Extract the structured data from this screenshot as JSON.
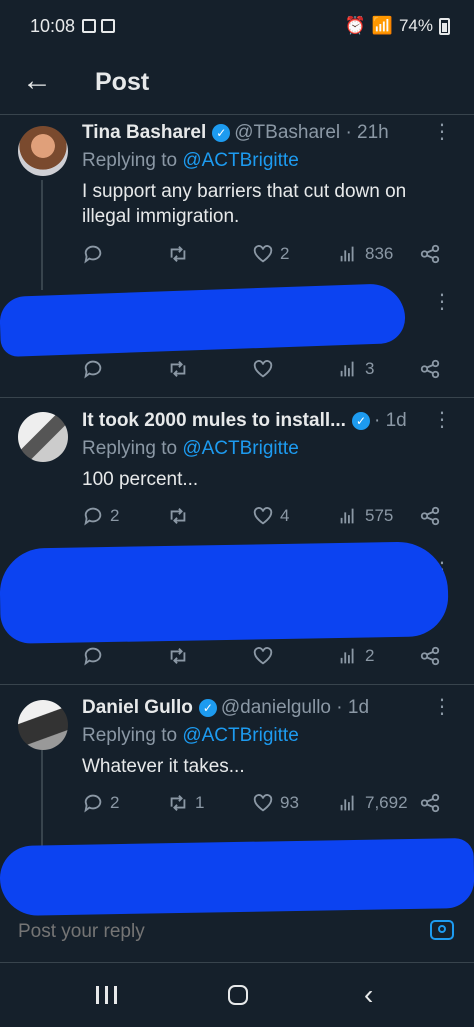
{
  "status": {
    "time": "10:08",
    "battery": "74%"
  },
  "header": {
    "title": "Post"
  },
  "posts": [
    {
      "name": "Tina Basharel",
      "handle": "@TBasharel",
      "time": "· 21h",
      "replying_prefix": "Replying to ",
      "replying_to": "@ACTBrigitte",
      "text": "I support any barriers that cut down on illegal immigration.",
      "replies": "",
      "reposts": "",
      "likes": "2",
      "views": "836"
    },
    {
      "name": "",
      "handle": "",
      "time": "",
      "replying_prefix": "",
      "replying_to": "",
      "text": "",
      "replies": "",
      "reposts": "",
      "likes": "",
      "views": "3"
    },
    {
      "name": "It took 2000 mules to install...",
      "handle": "",
      "time": "· 1d",
      "replying_prefix": "Replying to ",
      "replying_to": "@ACTBrigitte",
      "text": "100 percent...",
      "replies": "2",
      "reposts": "",
      "likes": "4",
      "views": "575"
    },
    {
      "name": "",
      "handle": "",
      "time": "",
      "replying_prefix": "",
      "replying_to": "",
      "text": "",
      "replies": "",
      "reposts": "",
      "likes": "",
      "views": "2"
    },
    {
      "name": "Daniel Gullo",
      "handle": "@danielgullo",
      "time": "· 1d",
      "replying_prefix": "Replying to ",
      "replying_to": "@ACTBrigitte",
      "text": "Whatever it takes...",
      "replies": "2",
      "reposts": "1",
      "likes": "93",
      "views": "7,692"
    }
  ],
  "composer": {
    "placeholder": "Post your reply"
  },
  "colors": {
    "background": "#15202b",
    "accent": "#1d9bf0",
    "redaction": "#0c43f1"
  }
}
